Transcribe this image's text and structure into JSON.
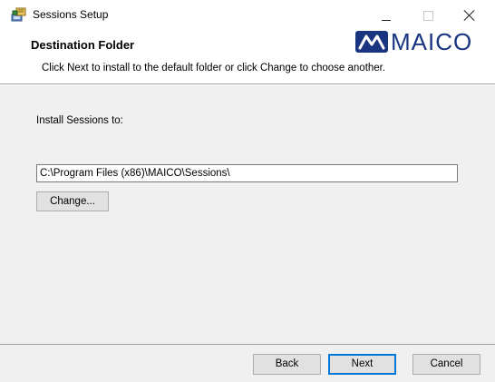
{
  "window": {
    "title": "Sessions Setup",
    "icon": "installer-icon"
  },
  "header": {
    "title": "Destination Folder",
    "subtitle": "Click Next to install to the default folder or click Change to choose another.",
    "logo_text": "MAICO",
    "logo_color": "#1a3580"
  },
  "main": {
    "install_label": "Install Sessions to:",
    "install_path": "C:\\Program Files (x86)\\MAICO\\Sessions\\",
    "change_label": "Change..."
  },
  "footer": {
    "back_label": "Back",
    "next_label": "Next",
    "cancel_label": "Cancel"
  },
  "colors": {
    "accent": "#0078d7",
    "panel": "#f0f0f0"
  }
}
